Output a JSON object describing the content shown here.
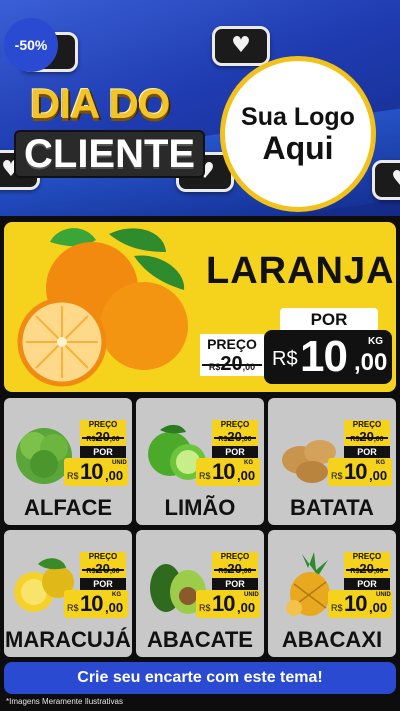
{
  "header": {
    "headline_line1": "DIA DO",
    "headline_line2": "CLIENTE",
    "logo_line1": "Sua Logo",
    "logo_line2": "Aqui"
  },
  "featured": {
    "discount": "-50%",
    "name": "LARANJA",
    "old_label": "PREÇO",
    "old_currency": "R$",
    "old_int": "20",
    "old_cents": ",00",
    "por_label": "POR",
    "new_currency": "R$",
    "new_int": "10",
    "new_cents": ",00",
    "unit": "KG"
  },
  "products": [
    {
      "name": "ALFACE",
      "old_label": "PREÇO",
      "old_currency": "R$",
      "old_int": "20",
      "old_cents": ",00",
      "por_label": "POR",
      "new_currency": "R$",
      "new_int": "10",
      "new_cents": ",00",
      "unit": "UNID"
    },
    {
      "name": "LIMÃO",
      "old_label": "PREÇO",
      "old_currency": "R$",
      "old_int": "20",
      "old_cents": ",00",
      "por_label": "POR",
      "new_currency": "R$",
      "new_int": "10",
      "new_cents": ",00",
      "unit": "KG"
    },
    {
      "name": "BATATA",
      "old_label": "PREÇO",
      "old_currency": "R$",
      "old_int": "20",
      "old_cents": ",00",
      "por_label": "POR",
      "new_currency": "R$",
      "new_int": "10",
      "new_cents": ",00",
      "unit": "KG"
    },
    {
      "name": "MARACUJÁ",
      "old_label": "PREÇO",
      "old_currency": "R$",
      "old_int": "20",
      "old_cents": ",00",
      "por_label": "POR",
      "new_currency": "R$",
      "new_int": "10",
      "new_cents": ",00",
      "unit": "KG"
    },
    {
      "name": "ABACATE",
      "old_label": "PREÇO",
      "old_currency": "R$",
      "old_int": "20",
      "old_cents": ",00",
      "por_label": "POR",
      "new_currency": "R$",
      "new_int": "10",
      "new_cents": ",00",
      "unit": "UNID"
    },
    {
      "name": "ABACAXI",
      "old_label": "PREÇO",
      "old_currency": "R$",
      "old_int": "20",
      "old_cents": ",00",
      "por_label": "POR",
      "new_currency": "R$",
      "new_int": "10",
      "new_cents": ",00",
      "unit": "UNID"
    }
  ],
  "footer": {
    "cta": "Crie seu encarte com este tema!",
    "disclaimer": "*Imagens Meramente Ilustrativas"
  },
  "colors": {
    "brand_blue": "#2a4bd1",
    "yellow": "#f5d21b",
    "card_gray": "#c8c8c8",
    "background": "#0d0d0d"
  },
  "icons": [
    "heart-bubble-icon",
    "orange-image",
    "lettuce-image",
    "lime-image",
    "potato-image",
    "passion-fruit-image",
    "avocado-image",
    "pineapple-image"
  ]
}
